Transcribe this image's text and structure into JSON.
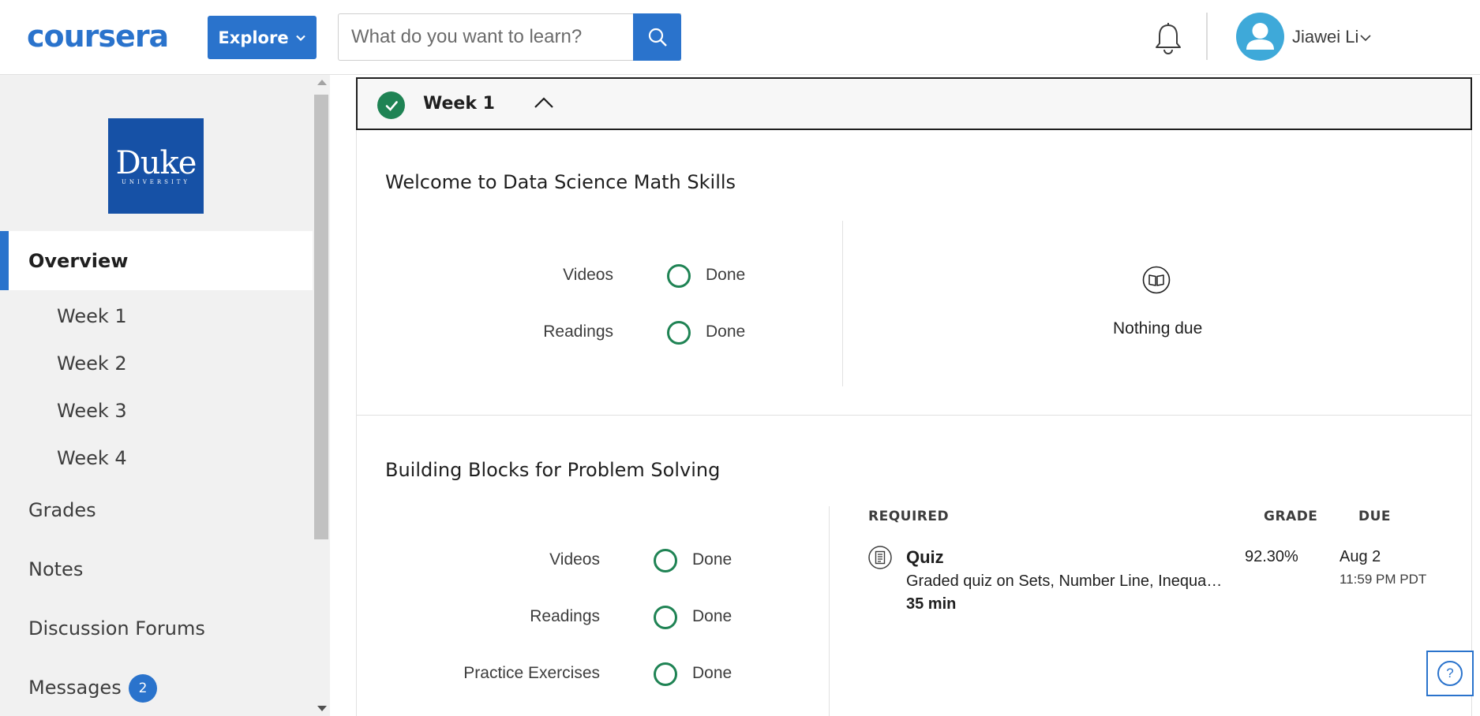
{
  "header": {
    "logo_text": "coursera",
    "explore_label": "Explore",
    "search_placeholder": "What do you want to learn?",
    "user_name": "Jiawei Li"
  },
  "sidebar": {
    "university_name": "Duke",
    "university_sub": "UNIVERSITY",
    "overview": "Overview",
    "weeks": [
      "Week 1",
      "Week 2",
      "Week 3",
      "Week 4"
    ],
    "grades": "Grades",
    "notes": "Notes",
    "forums": "Discussion Forums",
    "messages": "Messages",
    "messages_count": "2"
  },
  "week": {
    "title": "Week 1",
    "completed": true
  },
  "lessons": [
    {
      "title": "Welcome to Data Science Math Skills",
      "progress": [
        {
          "label": "Videos",
          "status": "Done"
        },
        {
          "label": "Readings",
          "status": "Done"
        }
      ],
      "nothing_due": "Nothing due"
    },
    {
      "title": "Building Blocks for Problem Solving",
      "progress": [
        {
          "label": "Videos",
          "status": "Done"
        },
        {
          "label": "Readings",
          "status": "Done"
        },
        {
          "label": "Practice Exercises",
          "status": "Done"
        }
      ],
      "columns": {
        "required": "REQUIRED",
        "grade": "GRADE",
        "due": "DUE"
      },
      "assignment": {
        "title": "Quiz",
        "description": "Graded quiz on Sets, Number Line, Inequalities, Summation",
        "duration": "35 min",
        "grade": "92.30%",
        "due_date": "Aug 2",
        "due_time": "11:59 PM PDT"
      }
    }
  ],
  "help_label": "?",
  "colors": {
    "brand_blue": "#2a73cc",
    "success_green": "#1f8354",
    "sidebar_bg": "#f1f1f1"
  }
}
